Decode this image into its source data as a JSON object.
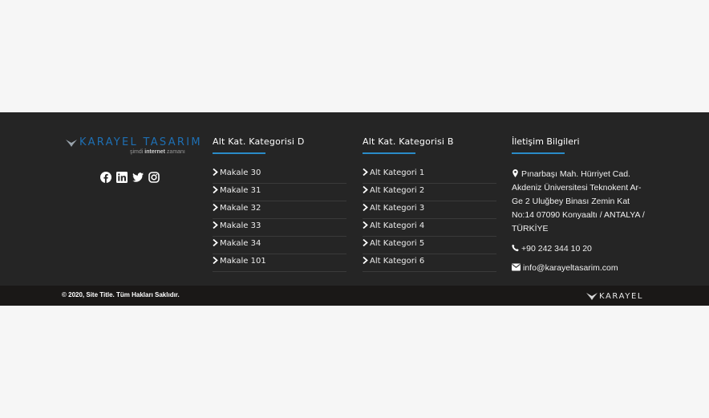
{
  "brand": {
    "logo_text": "KARAYEL TASARIM",
    "tagline_pre": "şimdi",
    "tagline_bold": "internet",
    "tagline_post": "zamanı",
    "accent": "#1e6fb3"
  },
  "social": [
    "facebook-icon",
    "linkedin-icon",
    "twitter-icon",
    "instagram-icon"
  ],
  "col1": {
    "title": "Alt Kat. Kategorisi D",
    "items": [
      "Makale 30",
      "Makale 31",
      "Makale 32",
      "Makale 33",
      "Makale 34",
      "Makale 101"
    ]
  },
  "col2": {
    "title": "Alt Kat. Kategorisi B",
    "items": [
      "Alt Kategori 1",
      "Alt Kategori 2",
      "Alt Kategori 3",
      "Alt Kategori 4",
      "Alt Kategori 5",
      "Alt Kategori 6"
    ]
  },
  "contact": {
    "title": "İletişim Bilgileri",
    "address_lines": [
      "Pınarbaşı Mah. Hürriyet Cad.",
      "Akdeniz Üniversitesi Teknokent Ar-",
      "Ge 2 Uluğbey Binası Zemin Kat",
      "No:14 07090 Konyaaltı / ANTALYA /",
      "TÜRKİYE"
    ],
    "phone": "+90 242 344 10 20",
    "email": "info@karayeltasarim.com"
  },
  "footer": {
    "copyright": "© 2020, Site Title. Tüm Hakları Saklıdır.",
    "bottom_logo": "KARAYEL"
  },
  "colors": {
    "footer_bg": "#252525",
    "bottom_bg": "#1a1817",
    "underline": "#2a8bc8"
  }
}
